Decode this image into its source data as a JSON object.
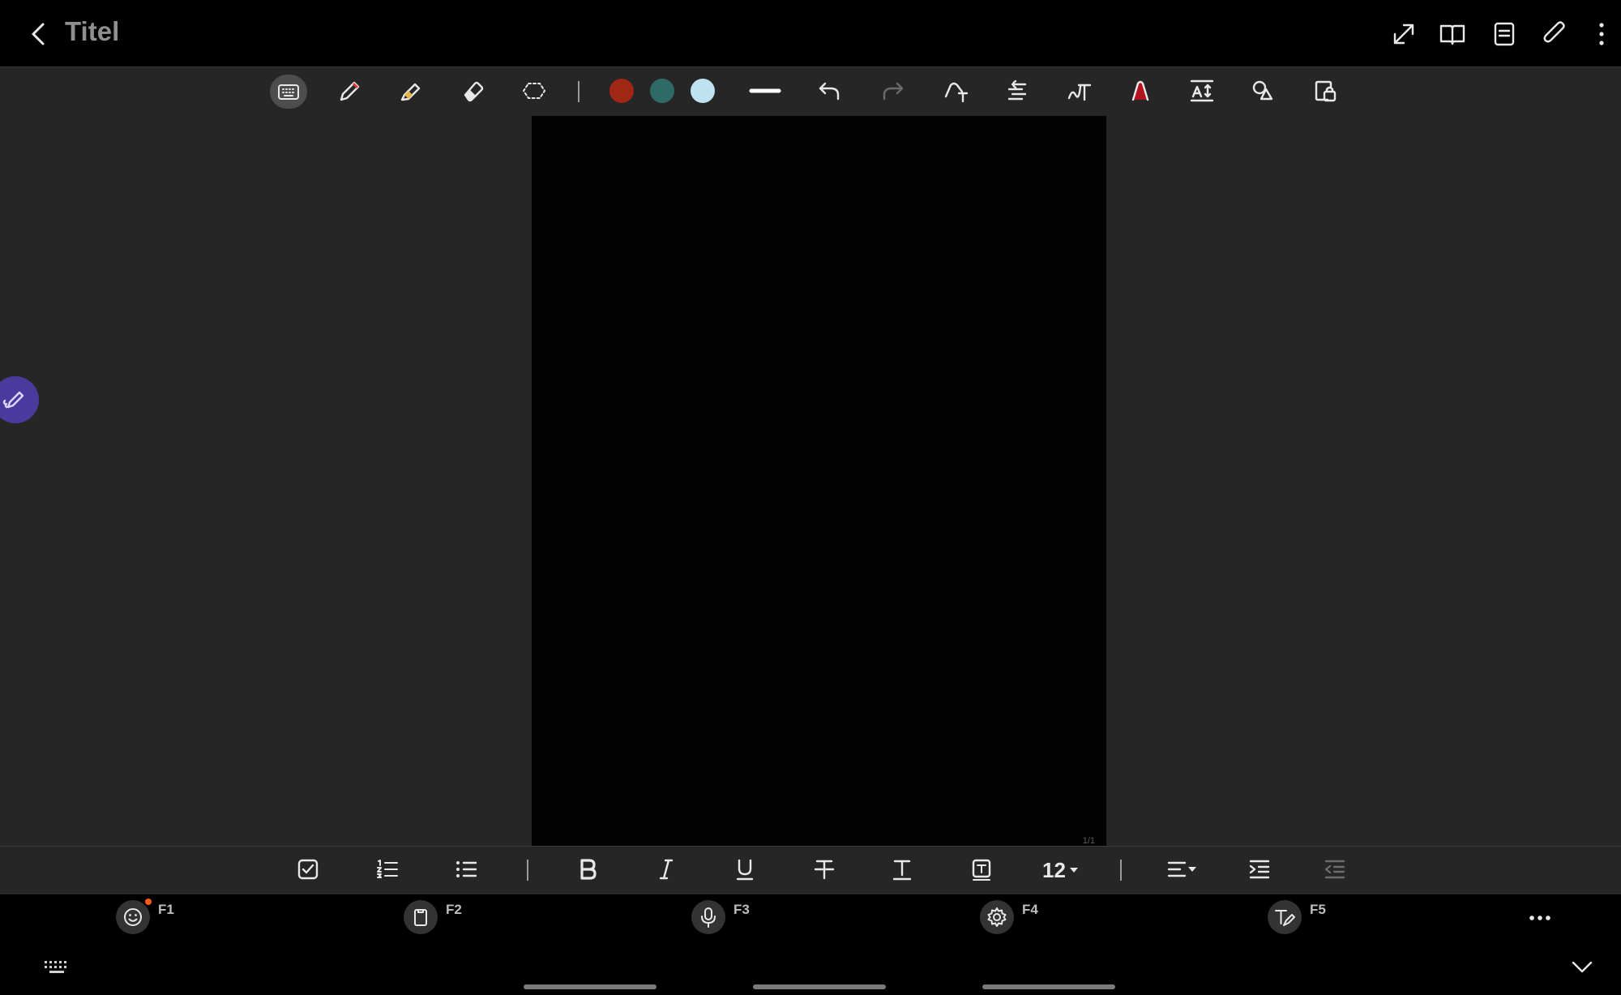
{
  "app": {
    "title": "Titel"
  },
  "header_icons": [
    "back-arrow-icon",
    "expand-icon",
    "book-view-icon",
    "page-list-icon",
    "paperclip-icon",
    "more-vert-icon"
  ],
  "toolbar": {
    "tools": [
      "keyboard-icon",
      "pen-icon",
      "highlighter-icon",
      "eraser-icon",
      "lasso-icon"
    ],
    "colors": [
      "#a02714",
      "#2e6b66",
      "#bfe2f2"
    ],
    "actions": [
      "stroke-width-icon",
      "undo-icon",
      "redo-icon",
      "text-insert-icon",
      "align-text-icon",
      "handwriting-icon",
      "pen-fill-icon",
      "text-spacing-icon",
      "shapes-icon",
      "lock-icon"
    ]
  },
  "canvas": {
    "page_indicator": "1/1"
  },
  "format_bar": {
    "font_size": "12",
    "tools": [
      "checkbox-icon",
      "numbered-list-icon",
      "bullet-list-icon",
      "bold-icon",
      "italic-icon",
      "underline-icon",
      "strikethrough-icon",
      "text-style-icon",
      "text-box-icon",
      "align-icon",
      "indent-icon",
      "outdent-icon"
    ]
  },
  "fkeys": [
    {
      "label": "F1",
      "icon": "emoji-icon"
    },
    {
      "label": "F2",
      "icon": "clipboard-icon"
    },
    {
      "label": "F3",
      "icon": "microphone-icon"
    },
    {
      "label": "F4",
      "icon": "settings-icon"
    },
    {
      "label": "F5",
      "icon": "handwriting-keyboard-icon"
    }
  ],
  "colors": {
    "accent": "#4b3a9e",
    "notify_dot": "#ff5a1f",
    "canvas": "#030303",
    "panel": "#262626"
  }
}
